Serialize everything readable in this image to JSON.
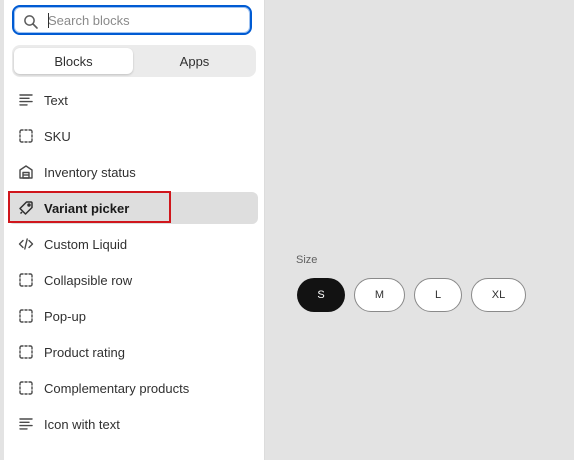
{
  "search": {
    "placeholder": "Search blocks",
    "value": ""
  },
  "tabs": [
    {
      "label": "Blocks",
      "active": true
    },
    {
      "label": "Apps",
      "active": false
    }
  ],
  "blocks": [
    {
      "label": "Text",
      "icon": "text-lines-icon"
    },
    {
      "label": "SKU",
      "icon": "dashed-square-icon"
    },
    {
      "label": "Inventory status",
      "icon": "warehouse-icon"
    },
    {
      "label": "Variant picker",
      "icon": "variant-icon",
      "selected": true
    },
    {
      "label": "Custom Liquid",
      "icon": "code-icon"
    },
    {
      "label": "Collapsible row",
      "icon": "dashed-square-icon"
    },
    {
      "label": "Pop-up",
      "icon": "dashed-square-icon"
    },
    {
      "label": "Product rating",
      "icon": "dashed-square-icon"
    },
    {
      "label": "Complementary products",
      "icon": "dashed-square-icon"
    },
    {
      "label": "Icon with text",
      "icon": "text-lines-icon"
    }
  ],
  "preview": {
    "size_label": "Size",
    "options": [
      {
        "label": "S",
        "selected": true
      },
      {
        "label": "M",
        "selected": false
      },
      {
        "label": "L",
        "selected": false
      },
      {
        "label": "XL",
        "selected": false
      }
    ]
  },
  "colors": {
    "accent": "#005bd3",
    "highlight": "#d0161c",
    "selected_bg": "#dedede",
    "pill_selected": "#121212"
  }
}
